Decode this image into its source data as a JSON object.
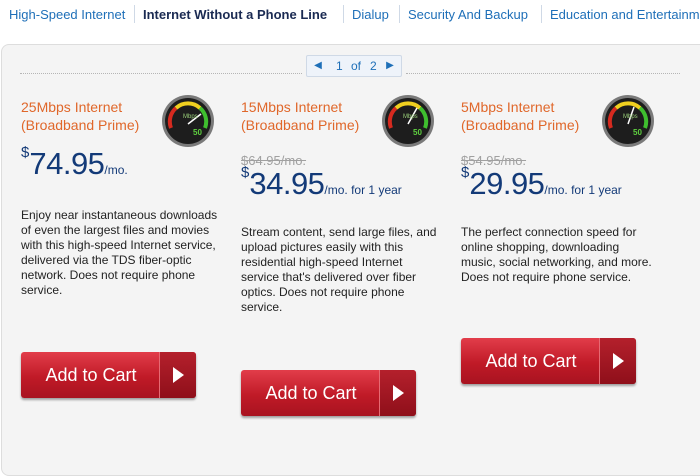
{
  "nav": {
    "tabs": [
      {
        "label": "High-Speed Internet",
        "active": false
      },
      {
        "label": "Internet Without a Phone Line",
        "active": true
      },
      {
        "label": "Dialup",
        "active": false
      },
      {
        "label": "Security And Backup",
        "active": false
      },
      {
        "label": "Education and Entertainment",
        "active": false
      }
    ]
  },
  "pager": {
    "prev_icon": "triangle-left-icon",
    "current": "1",
    "of": "of",
    "total": "2",
    "next_icon": "triangle-right-icon"
  },
  "offers": [
    {
      "title": "25Mbps Internet (Broadband Prime)",
      "gauge_icon": "speedometer-gauge-icon",
      "gauge_unit": "Mbps",
      "gauge_value": "50",
      "old_price": "",
      "currency": "$",
      "price": "74.95",
      "period": "/mo.",
      "description": "Enjoy near instantaneous downloads of even the largest files and movies with this high-speed Internet service, delivered via the TDS fiber-optic network. Does not require phone service.",
      "cart_label": "Add to Cart"
    },
    {
      "title": "15Mbps Internet (Broadband Prime)",
      "gauge_icon": "speedometer-gauge-icon",
      "gauge_unit": "Mbps",
      "gauge_value": "50",
      "old_price": "$64.95/mo.",
      "currency": "$",
      "price": "34.95",
      "period": "/mo. for 1 year",
      "description": "Stream content, send large files, and upload pictures easily with this residential high-speed Internet service that's delivered over fiber optics. Does not require phone service.",
      "cart_label": "Add to Cart"
    },
    {
      "title": "5Mbps Internet (Broadband Prime)",
      "gauge_icon": "speedometer-gauge-icon",
      "gauge_unit": "Mbps",
      "gauge_value": "50",
      "old_price": "$54.95/mo.",
      "currency": "$",
      "price": "29.95",
      "period": "/mo. for 1 year",
      "description": "The perfect connection speed for online shopping, downloading music, social networking, and more. Does not require phone service.",
      "cart_label": "Add to Cart"
    }
  ],
  "colors": {
    "title": "#e0672a",
    "price": "#133a78",
    "nav_link": "#1e6fb8",
    "nav_active": "#1a2a52",
    "cart": "#c01a27"
  }
}
